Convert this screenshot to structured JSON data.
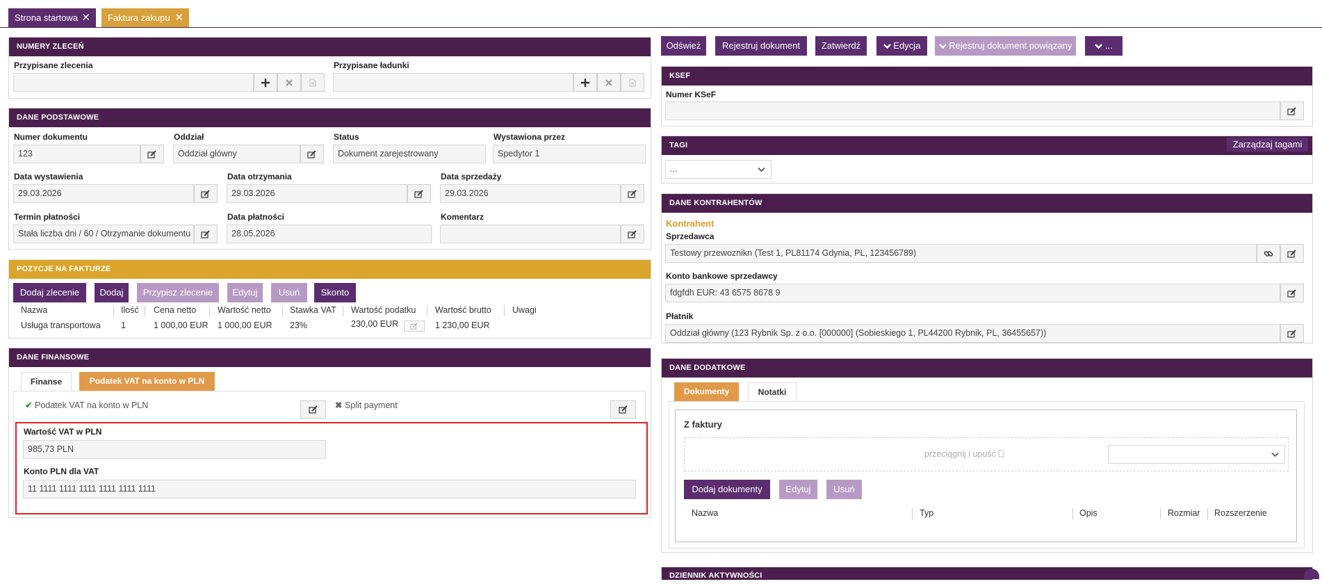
{
  "tabs": [
    {
      "label": "Strona startowa"
    },
    {
      "label": "Faktura zakupu"
    }
  ],
  "close_glyph": "✕",
  "orders": {
    "header": "NUMERY ZLECEŃ",
    "assigned_orders_label": "Przypisane zlecenia",
    "assigned_loads_label": "Przypisane ładunki"
  },
  "basic": {
    "header": "DANE PODSTAWOWE",
    "doc_number_label": "Numer dokumentu",
    "doc_number": "123",
    "branch_label": "Oddział",
    "branch": "Oddział główny",
    "status_label": "Status",
    "status": "Dokument zarejestrowany",
    "issued_by_label": "Wystawiona przez",
    "issued_by": "Spedytor 1",
    "issue_date_label": "Data wystawienia",
    "issue_date": "29.03.2026",
    "receipt_date_label": "Data otrzymania",
    "receipt_date": "29.03.2026",
    "sale_date_label": "Data sprzedaży",
    "sale_date": "29.03.2026",
    "payment_term_label": "Termin płatności",
    "payment_term": "Stała liczba dni / 60 / Otrzymanie dokumentu",
    "payment_date_label": "Data płatności",
    "payment_date": "28.05.2026",
    "comment_label": "Komentarz",
    "comment": ""
  },
  "items": {
    "header": "POZYCJE NA FAKTURZE",
    "buttons": {
      "add_order": "Dodaj zlecenie",
      "add": "Dodaj",
      "assign_order": "Przypisz zlecenie",
      "edit": "Edytuj",
      "remove": "Usuń",
      "discount": "Skonto"
    },
    "columns": [
      "Nazwa",
      "Ilość",
      "Cena netto",
      "Wartość netto",
      "Stawka VAT",
      "Wartość podatku",
      "Wartość brutto",
      "Uwagi"
    ],
    "rows": [
      {
        "name": "Usługa transportowa",
        "qty": "1",
        "net_price": "1 000,00 EUR",
        "net_value": "1 000,00 EUR",
        "vat_rate": "23%",
        "tax_value": "230,00 EUR",
        "gross_value": "1 230,00 EUR",
        "notes": ""
      }
    ]
  },
  "finance": {
    "header": "DANE FINANSOWE",
    "tabs": {
      "finance": "Finanse",
      "vat_pln": "Podatek VAT na konto w PLN"
    },
    "vat_pln_flag": "Podatek VAT na konto w PLN",
    "split_payment": "Split payment",
    "vat_value_label": "Wartość VAT w PLN",
    "vat_value": "985,73 PLN",
    "pln_account_label": "Konto PLN dla VAT",
    "pln_account": "11 1111 1111 1111 1111 1111 1111"
  },
  "toolbar": {
    "refresh": "Odśwież",
    "register": "Rejestruj dokument",
    "approve": "Zatwierdź",
    "edit": "Edycja",
    "register_related": "Rejestruj dokument powiązany",
    "more": "..."
  },
  "ksef": {
    "header": "KSEF",
    "number_label": "Numer KSeF",
    "number": ""
  },
  "tags": {
    "header": "TAGI",
    "manage": "Zarządzaj tagami",
    "selected": "..."
  },
  "contractors": {
    "header": "DANE KONTRAHENTÓW",
    "section": "Kontrahent",
    "seller_label": "Sprzedawca",
    "seller": "Testowy przewoznikn (Test 1, PL81174 Gdynia, PL, 123456789)",
    "bank_label": "Konto bankowe sprzedawcy",
    "bank": "fdgfdh EUR: 43 6575 8678 9",
    "payer_label": "Płatnik",
    "payer": "Oddział główny (123 Rybnik Sp. z o.o. [000000] (Sobieskiego 1, PL44200 Rybnik, PL, 36455657))"
  },
  "extra": {
    "header": "DANE DODATKOWE",
    "tabs": {
      "documents": "Dokumenty",
      "notes": "Notatki"
    },
    "from_invoice": "Z faktury",
    "drop_hint": "przeciągnij i upuść",
    "buttons": {
      "add_docs": "Dodaj dokumenty",
      "edit": "Edytuj",
      "remove": "Usuń"
    },
    "columns": [
      "Nazwa",
      "Typ",
      "Opis",
      "Rozmiar",
      "Rozszerzenie"
    ]
  },
  "activity": {
    "header": "DZIENNIK AKTYWNOŚCI"
  },
  "colors": {
    "primary": "#4b1f4d",
    "button": "#5b2d6e",
    "button_disabled": "#b79ac4",
    "gold": "#dba42b",
    "orange_tab": "#e09a4a",
    "highlight": "#e02020",
    "check": "#2e9e2e"
  }
}
